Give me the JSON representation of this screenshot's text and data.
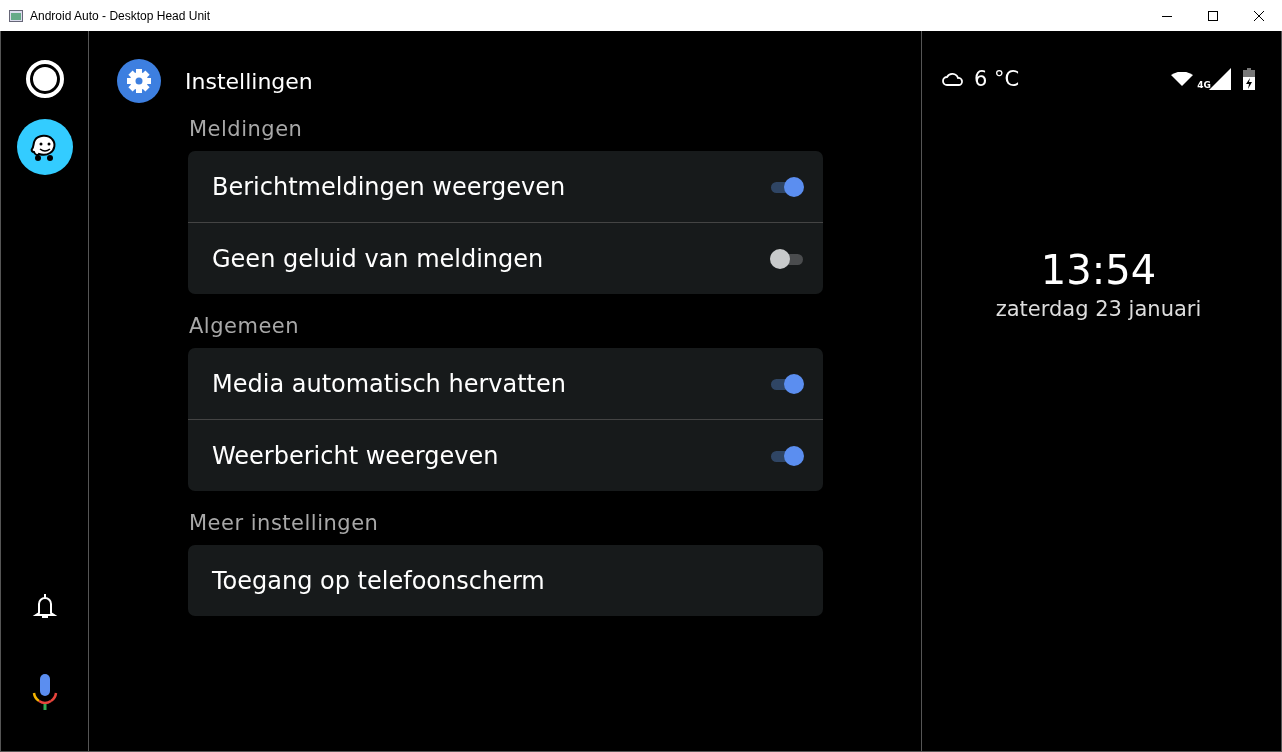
{
  "window": {
    "title": "Android Auto - Desktop Head Unit"
  },
  "header": {
    "title": "Instellingen"
  },
  "sections": [
    {
      "title": "Meldingen",
      "rows": [
        {
          "kind": "toggle",
          "label": "Berichtmeldingen weergeven",
          "on": true
        },
        {
          "kind": "toggle",
          "label": "Geen geluid van meldingen",
          "on": false
        }
      ]
    },
    {
      "title": "Algemeen",
      "rows": [
        {
          "kind": "toggle",
          "label": "Media automatisch hervatten",
          "on": true
        },
        {
          "kind": "toggle",
          "label": "Weerbericht weergeven",
          "on": true
        }
      ]
    },
    {
      "title": "Meer instellingen",
      "rows": [
        {
          "kind": "link",
          "label": "Toegang op telefoonscherm"
        }
      ]
    }
  ],
  "status": {
    "temperature": "6 °C",
    "network": "4G"
  },
  "clock": {
    "time": "13:54",
    "date": "zaterdag 23 januari"
  }
}
